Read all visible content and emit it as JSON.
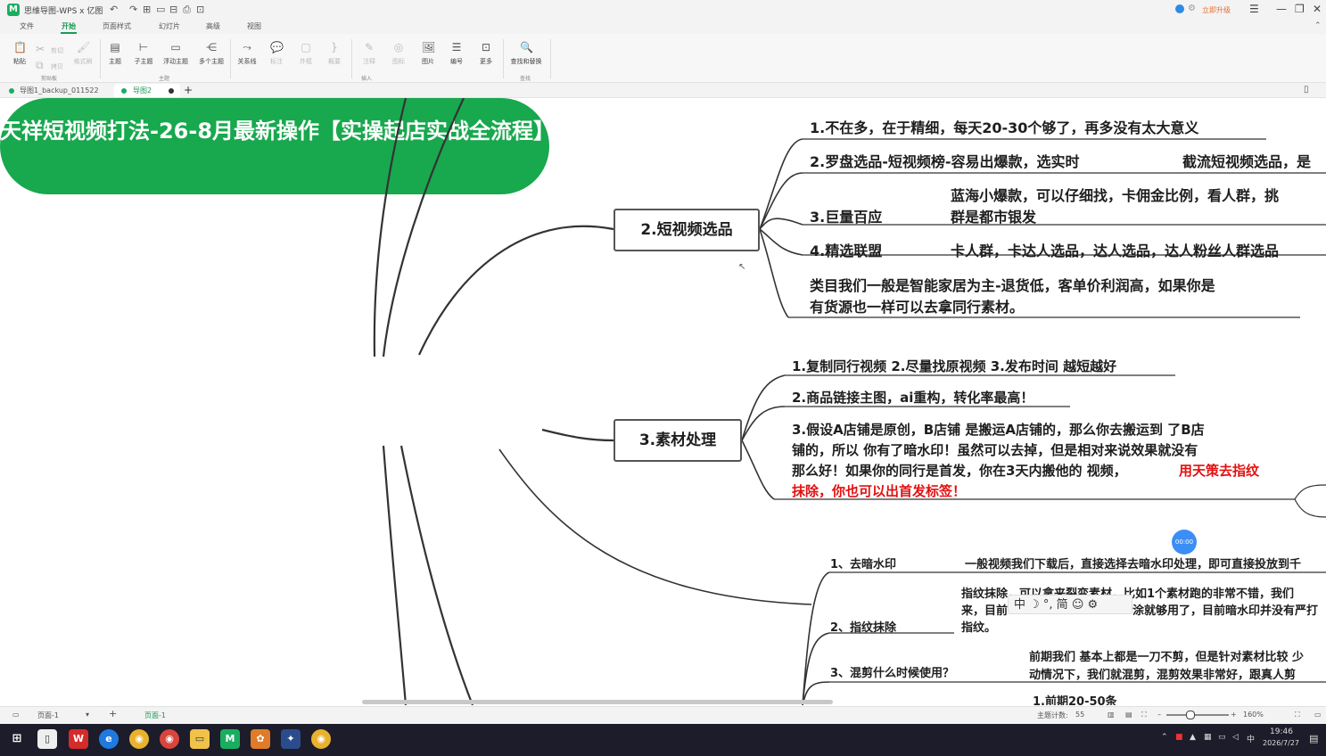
{
  "window": {
    "app_icon": "M",
    "title": "思维导图-WPS x 亿图",
    "quick_access": [
      "↶",
      "↷",
      "⊞",
      "▭",
      "⊟",
      "⎙",
      "⊡"
    ],
    "right_badge": "立即升级",
    "controls": [
      "☰",
      "—",
      "❐",
      "✕"
    ]
  },
  "menu": {
    "tabs": [
      "文件",
      "开始",
      "页面样式",
      "幻灯片",
      "高级",
      "视图"
    ],
    "active": "开始"
  },
  "ribbon": {
    "buttons": [
      {
        "id": "paste",
        "label": "粘贴",
        "icon": "clipboard-icon",
        "glyph": "📋"
      },
      {
        "id": "cut",
        "label": "剪切",
        "icon": "scissors-icon",
        "glyph": "✂",
        "disabled": true
      },
      {
        "id": "copy",
        "label": "拷贝",
        "icon": "copy-icon",
        "glyph": "⧉",
        "disabled": true
      },
      {
        "id": "format",
        "label": "格式刷",
        "icon": "brush-icon",
        "glyph": "🖌",
        "disabled": true
      },
      {
        "id": "topic",
        "label": "主题",
        "icon": "topic-icon",
        "glyph": "▤"
      },
      {
        "id": "subtopic",
        "label": "子主题",
        "icon": "subtopic-icon",
        "glyph": "⊢"
      },
      {
        "id": "float",
        "label": "浮动主题",
        "icon": "float-topic-icon",
        "glyph": "▭"
      },
      {
        "id": "multi",
        "label": "多个主题",
        "icon": "multi-topic-icon",
        "glyph": "⋲"
      },
      {
        "id": "relation",
        "label": "关系线",
        "icon": "relation-icon",
        "glyph": "⤳"
      },
      {
        "id": "callout",
        "label": "标注",
        "icon": "callout-icon",
        "glyph": "💬",
        "disabled": true
      },
      {
        "id": "boundary",
        "label": "外框",
        "icon": "boundary-icon",
        "glyph": "▢",
        "disabled": true
      },
      {
        "id": "summary",
        "label": "概要",
        "icon": "summary-icon",
        "glyph": "}",
        "disabled": true
      },
      {
        "id": "note",
        "label": "注释",
        "icon": "note-icon",
        "glyph": "✎",
        "disabled": true
      },
      {
        "id": "mark",
        "label": "图标",
        "icon": "mark-icon",
        "glyph": "◎",
        "disabled": true
      },
      {
        "id": "image",
        "label": "图片",
        "icon": "image-icon",
        "glyph": "🖼"
      },
      {
        "id": "number",
        "label": "编号",
        "icon": "numbering-icon",
        "glyph": "☰"
      },
      {
        "id": "more",
        "label": "更多",
        "icon": "more-icon",
        "glyph": "⊡"
      },
      {
        "id": "find",
        "label": "查找和替换",
        "icon": "find-replace-icon",
        "glyph": "🔍"
      }
    ],
    "groups": [
      "剪贴板",
      "主题",
      "插入",
      "查找"
    ]
  },
  "doc_tabs": [
    {
      "label": "导图1_backup_011522",
      "dirty": false
    },
    {
      "label": "导图2",
      "dirty": true
    }
  ],
  "add_tab": "+",
  "mindmap": {
    "root": "天祥短视频打法-26-8月最新操作【实操起店实战全流程】",
    "branch2": {
      "title": "2.短视频选品",
      "items": [
        "1.不在多，在于精细，每天20-30个够了，再多没有太大意义",
        "2.罗盘选品-短视频榜-容易出爆款，选实时",
        "截流短视频选品，是",
        "3.巨量百应",
        "蓝海小爆款，可以仔细找，卡佣金比例，看人群，挑",
        "群是都市银发",
        "4.精选联盟",
        "卡人群，卡达人选品，达人选品，达人粉丝人群选品",
        "类目我们一般是智能家居为主-退货低，客单价利润高，如果你是",
        "有货源也一样可以去拿同行素材。"
      ]
    },
    "branch3": {
      "title": "3.素材处理",
      "items": [
        "1.复制同行视频  2.尽量找原视频  3.发布时间 越短越好",
        "2.商品链接主图，ai重构，转化率最高！",
        "3.假设A店铺是原创，B店铺 是搬运A店铺的，那么你去搬运到 了B店",
        "铺的，所以 你有了暗水印！虽然可以去掉，但是相对来说效果就没有",
        "那么好！如果你的同行是首发，你在3天内搬他的 视频，",
        "用天策去指纹",
        "抹除，你也可以出首发标签！"
      ]
    },
    "branch4": {
      "items": [
        "1、去暗水印",
        "一般视频我们下载后，直接选择去暗水印处理，即可直接投放到千",
        "2、指纹抹除",
        "指纹抹除，可以拿来裂变素材，比如1个素材跑的非常不错，我们",
        "来，目前",
        "涂就够用了，目前暗水印并没有严打",
        "指纹。",
        "3、混剪什么时候使用？",
        "前期我们 基本上都是一刀不剪，但是针对素材比较 少",
        "动情况下，我们就混剪，混剪效果非常好，跟真人剪",
        "1.前期20-50条"
      ]
    }
  },
  "ime_bar": "中 ☽ °, 简 ☺ ⚙",
  "recording": "00:00",
  "status": {
    "page_label": "页面-1",
    "add": "+",
    "active_page": "页面-1",
    "topic_count_label": "主题计数:",
    "topic_count": "55",
    "zoom": "160%"
  },
  "taskbar": {
    "time": "19:46",
    "date": "2026/7/27",
    "lang": "中"
  },
  "colors": {
    "accent": "#1a9a55",
    "root_fill": "#18a84e",
    "highlight_red": "#e31010",
    "branch_line": "#333333"
  }
}
